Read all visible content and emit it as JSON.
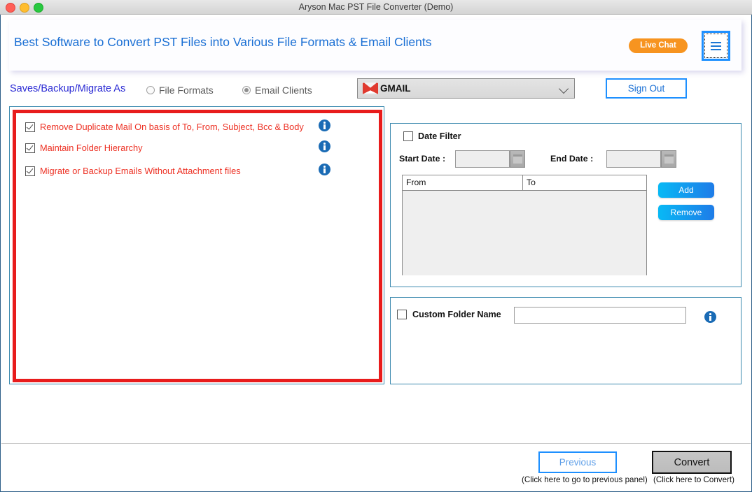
{
  "window": {
    "title": "Aryson Mac PST File Converter (Demo)",
    "traffic_lights": [
      "close-button",
      "minimize-button",
      "maximize-button"
    ]
  },
  "banner": {
    "headline": "Best Software to Convert PST Files into Various File Formats & Email Clients",
    "live_chat_label": "Live Chat",
    "menu_icon": "hamburger-menu-icon",
    "accent_color": "#1a6fd4",
    "live_chat_color": "#f79420"
  },
  "options_row": {
    "saves_label": "Saves/Backup/Migrate As",
    "radios": [
      {
        "label": "File Formats",
        "selected": false
      },
      {
        "label": "Email Clients",
        "selected": true
      }
    ],
    "target_select": {
      "value": "GMAIL",
      "icon": "gmail-logo-icon",
      "caret": "chevron-down-icon"
    },
    "sign_out_label": "Sign Out"
  },
  "left_panel": {
    "highlight_color": "#e81c1c",
    "label_color": "#ed3124",
    "options": [
      {
        "label": "Remove Duplicate Mail On basis of To, From, Subject, Bcc & Body",
        "checked": true,
        "info": "info-icon"
      },
      {
        "label": "Maintain Folder Hierarchy",
        "checked": true,
        "info": "info-icon"
      },
      {
        "label": "Migrate or Backup Emails Without Attachment files",
        "checked": true,
        "info": "info-icon"
      }
    ]
  },
  "date_filter_panel": {
    "checkbox_label": "Date Filter",
    "checked": false,
    "start_label": "Start Date :",
    "start_value": "",
    "start_placeholder": "",
    "end_label": "End Date :",
    "end_value": "",
    "end_placeholder": "",
    "calendar_icon": "calendar-icon",
    "table": {
      "columns": [
        "From",
        "To"
      ],
      "rows": []
    },
    "add_label": "Add",
    "remove_label": "Remove",
    "button_gradient_from": "#08b9f5",
    "button_gradient_to": "#1e7ce8"
  },
  "custom_folder_panel": {
    "checkbox_label": "Custom Folder Name",
    "checked": false,
    "value": "",
    "placeholder": "",
    "info": "info-icon"
  },
  "footer": {
    "previous_label": "Previous",
    "previous_hint": "(Click here to go to previous panel)",
    "convert_label": "Convert",
    "convert_hint": "(Click here to Convert)"
  }
}
